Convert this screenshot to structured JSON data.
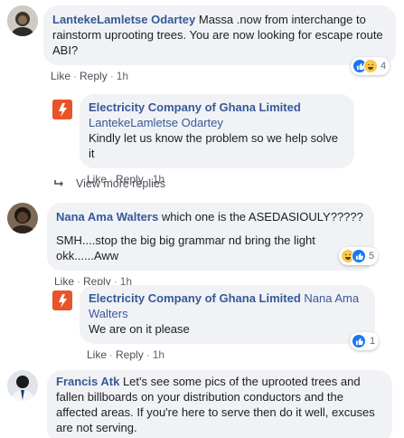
{
  "comments": [
    {
      "author": "LantekeLamletse Odartey",
      "text": "Massa .now from interchange to rainstorm uprooting trees. You are now looking for escape route ABI?",
      "like": "Like",
      "reply": "Reply",
      "time": "1h",
      "reaction_count": "4",
      "reactions": [
        "like-icon",
        "haha-icon"
      ]
    },
    {
      "author": "Nana Ama Walters",
      "line1": "which one is the ASEDASIOULY?????",
      "line2": "SMH....stop the big big grammar nd bring the light okk......Aww",
      "like": "Like",
      "reply": "Reply",
      "time": "1h",
      "reaction_count": "5",
      "reactions": [
        "haha-icon",
        "like-icon"
      ]
    },
    {
      "author": "Francis Atk",
      "text": "Let's see some pics of the uprooted trees and fallen billboards on your distribution conductors and the affected areas. If you're here to serve then do it well, excuses are not serving."
    }
  ],
  "replies": [
    {
      "author": "Electricity Company of Ghana Limited",
      "tagged": "LantekeLamletse Odartey",
      "text": "Kindly let us know the problem so we help solve it",
      "like": "Like",
      "reply": "Reply",
      "time": "1h"
    },
    {
      "author": "Electricity Company of Ghana Limited",
      "tagged": "Nana Ama Walters",
      "text": "We are on it please",
      "like": "Like",
      "reply": "Reply",
      "time": "1h",
      "reaction_count": "1",
      "reactions": [
        "like-icon"
      ]
    }
  ],
  "view_more": "View more replies",
  "colors": {
    "link": "#385898",
    "bubble": "#f0f2f5",
    "like_blue": "#1877f2",
    "haha_yellow": "#f7c94b",
    "ecg_orange": "#e8542a"
  }
}
